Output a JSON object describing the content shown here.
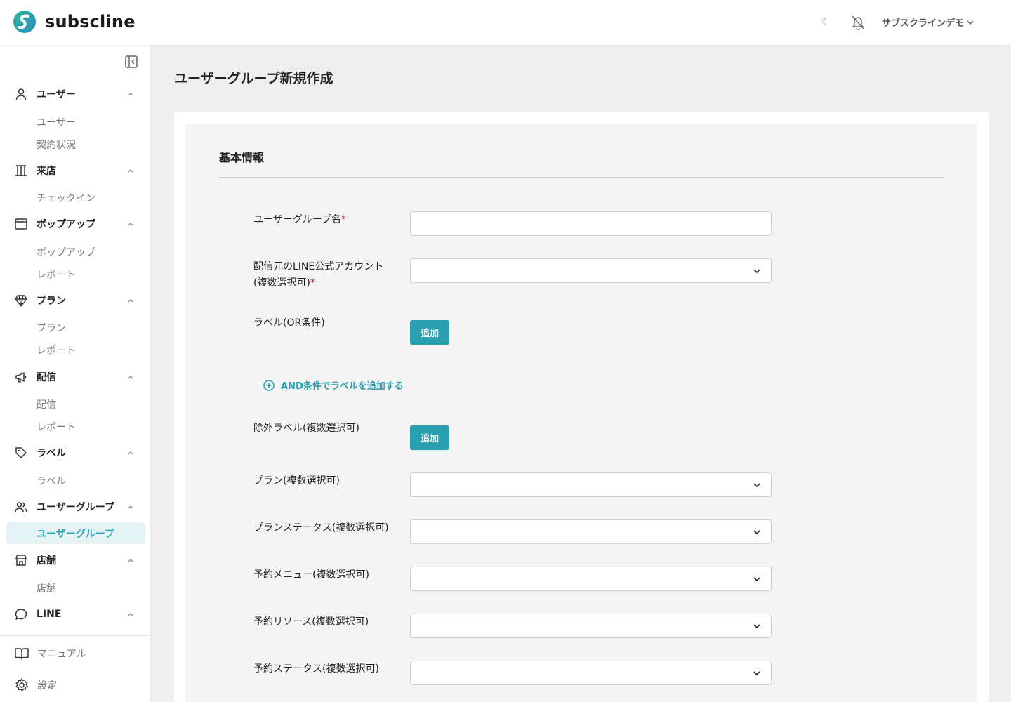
{
  "header": {
    "brand": "subscline",
    "moon_glyph": "☾",
    "user_name": "サブスクラインデモ",
    "icons": [
      "logo-icon",
      "moon-icon",
      "bell-off-icon",
      "chevron-down-icon"
    ]
  },
  "sidebar": {
    "groups": [
      {
        "label": "ユーザー",
        "icon": "user-icon",
        "items": [
          "ユーザー",
          "契約状況"
        ]
      },
      {
        "label": "来店",
        "icon": "building-icon",
        "items": [
          "チェックイン"
        ]
      },
      {
        "label": "ポップアップ",
        "icon": "window-icon",
        "items": [
          "ポップアップ",
          "レポート"
        ]
      },
      {
        "label": "プラン",
        "icon": "diamond-icon",
        "items": [
          "プラン",
          "レポート"
        ]
      },
      {
        "label": "配信",
        "icon": "megaphone-icon",
        "items": [
          "配信",
          "レポート"
        ]
      },
      {
        "label": "ラベル",
        "icon": "tag-icon",
        "items": [
          "ラベル"
        ]
      },
      {
        "label": "ユーザーグループ",
        "icon": "users-icon",
        "items": [
          "ユーザーグループ"
        ]
      },
      {
        "label": "店舗",
        "icon": "store-icon",
        "items": [
          "店舗"
        ]
      },
      {
        "label": "LINE",
        "icon": "chat-icon",
        "items": []
      }
    ],
    "active_item": "ユーザーグループ",
    "bottom": [
      {
        "label": "マニュアル",
        "icon": "book-icon"
      },
      {
        "label": "設定",
        "icon": "gear-icon"
      }
    ]
  },
  "main": {
    "title": "ユーザーグループ新規作成",
    "section_title": "基本情報",
    "fields": {
      "group_name": {
        "label": "ユーザーグループ名",
        "required_mark": "*",
        "value": ""
      },
      "line_account": {
        "label_line1": "配信元のLINE公式アカウント",
        "label_line2": "(複数選択可)",
        "required_mark": "*",
        "value": ""
      },
      "label_or": {
        "label": "ラベル(OR条件)",
        "button": "追加"
      },
      "and_link": "AND条件でラベルを追加する",
      "exclude_label": {
        "label": "除外ラベル(複数選択可)",
        "button": "追加"
      },
      "plan": {
        "label": "プラン(複数選択可)",
        "value": ""
      },
      "plan_status": {
        "label": "プランステータス(複数選択可)",
        "value": ""
      },
      "reservation_menu": {
        "label": "予約メニュー(複数選択可)",
        "value": ""
      },
      "reservation_resource": {
        "label": "予約リソース(複数選択可)",
        "value": ""
      },
      "reservation_status": {
        "label": "予約ステータス(複数選択可)",
        "value": ""
      }
    }
  },
  "colors": {
    "accent": "#2a9fb0",
    "active_bg": "#e6f3f5",
    "required": "#e0332f",
    "logo_gradient_start": "#2fb49c",
    "logo_gradient_end": "#2b8fc0"
  }
}
